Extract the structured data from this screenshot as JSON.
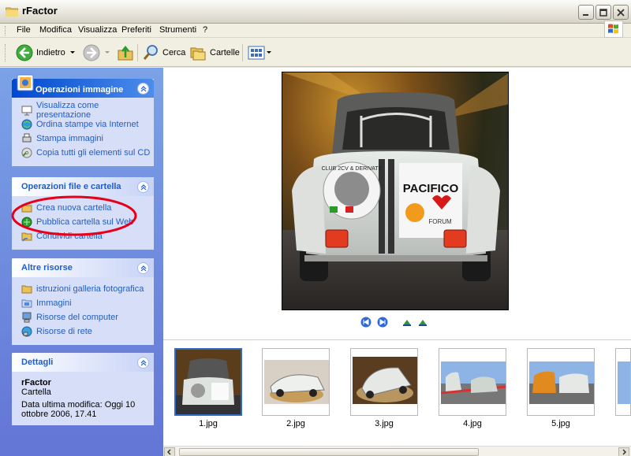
{
  "window": {
    "title": "rFactor"
  },
  "menu": [
    "File",
    "Modifica",
    "Visualizza",
    "Preferiti",
    "Strumenti",
    "?"
  ],
  "toolbar": {
    "back_label": "Indietro",
    "search_label": "Cerca",
    "folders_label": "Cartelle"
  },
  "panels": {
    "image_tasks": {
      "title": "Operazioni immagine",
      "items": [
        "Visualizza come presentazione",
        "Ordina stampe via Internet",
        "Stampa immagini",
        "Copia tutti gli elementi sul CD"
      ]
    },
    "file_tasks": {
      "title": "Operazioni file e cartella",
      "items": [
        "Crea nuova cartella",
        "Pubblica cartella sul Web",
        "Condividi cartella"
      ]
    },
    "other_places": {
      "title": "Altre risorse",
      "items": [
        "istruzioni galleria fotografica",
        "Immagini",
        "Risorse del computer",
        "Risorse di rete"
      ]
    },
    "details": {
      "title": "Dettagli",
      "name": "rFactor",
      "type": "Cartella",
      "modified_line1": "Data ultima modifica: Oggi 10",
      "modified_line2": "ottobre 2006, 17.41"
    }
  },
  "preview": {
    "sign_text": "PACIFICO",
    "sign_sub": "FORUM",
    "badge_text": "CLUB 2CV & DERIVATE"
  },
  "thumbnails": [
    "1.jpg",
    "2.jpg",
    "3.jpg",
    "4.jpg",
    "5.jpg"
  ],
  "colors": {
    "task_link": "#215dc6",
    "highlight_circle": "#e8001a",
    "selection": "#316ac5"
  }
}
